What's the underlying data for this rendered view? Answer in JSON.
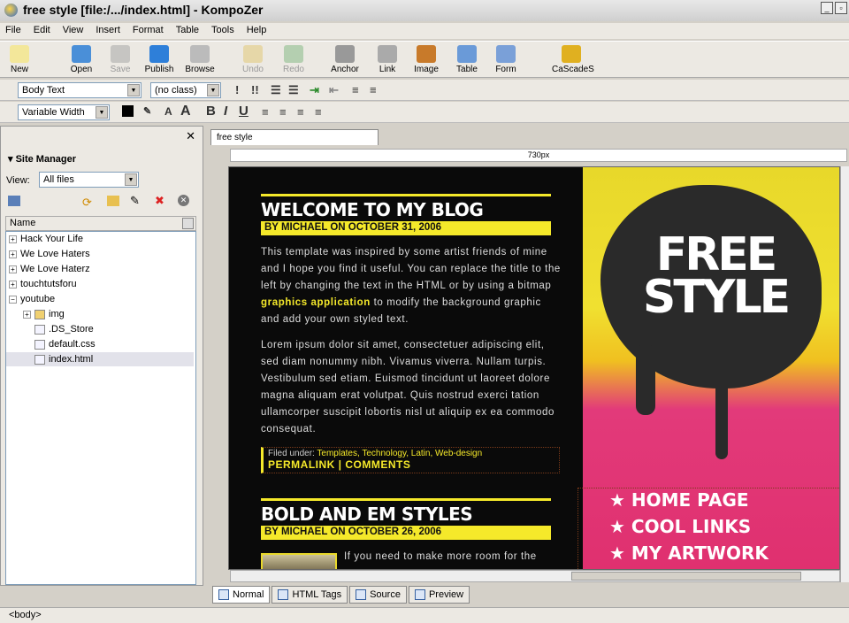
{
  "window": {
    "title": "free style [file:/.../index.html] - KompoZer"
  },
  "menu": [
    "File",
    "Edit",
    "View",
    "Insert",
    "Format",
    "Table",
    "Tools",
    "Help"
  ],
  "toolbar": [
    {
      "label": "New",
      "enabled": true
    },
    {
      "label": "Open",
      "enabled": true
    },
    {
      "label": "Save",
      "enabled": false
    },
    {
      "label": "Publish",
      "enabled": true
    },
    {
      "label": "Browse",
      "enabled": true
    },
    {
      "label": "Undo",
      "enabled": false
    },
    {
      "label": "Redo",
      "enabled": false
    },
    {
      "label": "Anchor",
      "enabled": true
    },
    {
      "label": "Link",
      "enabled": true
    },
    {
      "label": "Image",
      "enabled": true
    },
    {
      "label": "Table",
      "enabled": true
    },
    {
      "label": "Form",
      "enabled": true
    },
    {
      "label": "CaScadeS",
      "enabled": true
    }
  ],
  "format": {
    "paragraph": "Body Text",
    "class": "(no class)",
    "font": "Variable Width",
    "bold": "B",
    "italic": "I",
    "underline": "U"
  },
  "site_manager": {
    "title": "Site Manager",
    "view_label": "View:",
    "view_value": "All files",
    "column": "Name",
    "items": [
      {
        "label": "Hack Your Life",
        "level": 0,
        "exp": "+"
      },
      {
        "label": "We Love Haters",
        "level": 0,
        "exp": "+"
      },
      {
        "label": "We Love Haterz",
        "level": 0,
        "exp": "+"
      },
      {
        "label": "touchtutsforu",
        "level": 0,
        "exp": "+"
      },
      {
        "label": "youtube",
        "level": 0,
        "exp": "−"
      },
      {
        "label": "img",
        "level": 1,
        "exp": "+"
      },
      {
        "label": ".DS_Store",
        "level": 1,
        "exp": ""
      },
      {
        "label": "default.css",
        "level": 1,
        "exp": ""
      },
      {
        "label": "index.html",
        "level": 1,
        "exp": "",
        "selected": true
      }
    ]
  },
  "editor": {
    "tab": "free style",
    "ruler": "730px"
  },
  "page": {
    "post1": {
      "title": "WELCOME TO MY BLOG",
      "byline": "BY MICHAEL ON OCTOBER 31, 2006",
      "p1a": "This template was inspired by some artist friends of mine and I hope you find it useful. You can replace the title to the left by changing the text in the HTML or by using a bitmap ",
      "p1link": "graphics application",
      "p1b": " to modify the background graphic and add your own styled text.",
      "p2": "Lorem ipsum dolor sit amet, consectetuer adipiscing elit, sed diam nonummy nibh. Vivamus viverra. Nullam turpis. Vestibulum sed etiam. Euismod tincidunt ut laoreet dolore magna aliquam erat volutpat. Quis nostrud exerci tation ullamcorper suscipit lobortis nisl ut aliquip ex ea commodo consequat.",
      "filed_label": "Filed under: ",
      "tags": "Templates, Technology, Latin, Web-design",
      "links": "PERMALINK | COMMENTS"
    },
    "post2": {
      "title": "BOLD AND EM STYLES",
      "byline": "BY MICHAEL ON OCTOBER 26, 2006",
      "p1": "If you need to make more room for the"
    },
    "art_title": "FREE STYLE",
    "nav": [
      "HOME PAGE",
      "COOL LINKS",
      "MY ARTWORK"
    ]
  },
  "bottom_tabs": [
    "Normal",
    "HTML Tags",
    "Source",
    "Preview"
  ],
  "status": "<body>"
}
